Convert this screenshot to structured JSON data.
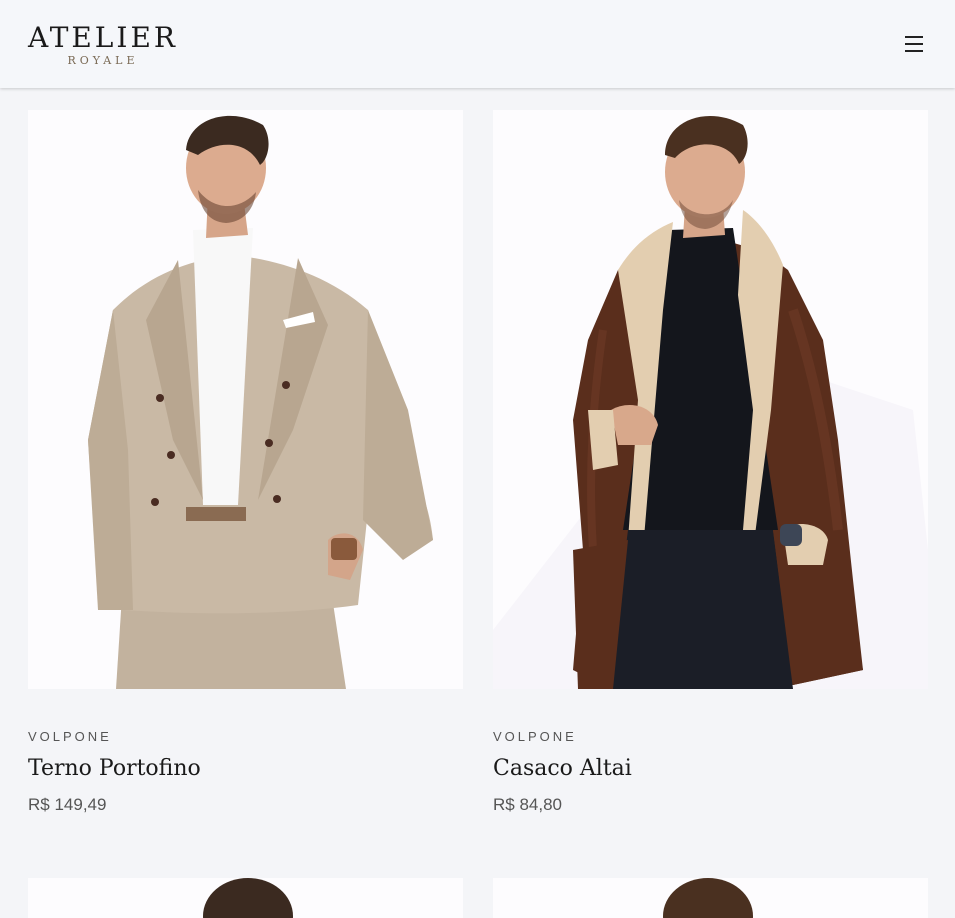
{
  "header": {
    "logo_main": "ATELIER",
    "logo_sub": "ROYALE",
    "menu_icon": "hamburger-menu-icon"
  },
  "products": [
    {
      "brand": "VOLPONE",
      "name": "Terno Portofino",
      "price": "R$ 149,49",
      "image_desc": "beige-suit-photo",
      "palette": {
        "outfit": "#c8b8a4",
        "shirt": "#ffffff",
        "hair": "#3b2a20",
        "skin": "#d9a88a"
      }
    },
    {
      "brand": "VOLPONE",
      "name": "Casaco Altai",
      "price": "R$ 84,80",
      "image_desc": "brown-shearling-coat-photo",
      "palette": {
        "outfit": "#5a2e1c",
        "shirt": "#14161c",
        "hair": "#4a3020",
        "skin": "#d9a88a",
        "lining": "#e3ceb0"
      }
    }
  ]
}
